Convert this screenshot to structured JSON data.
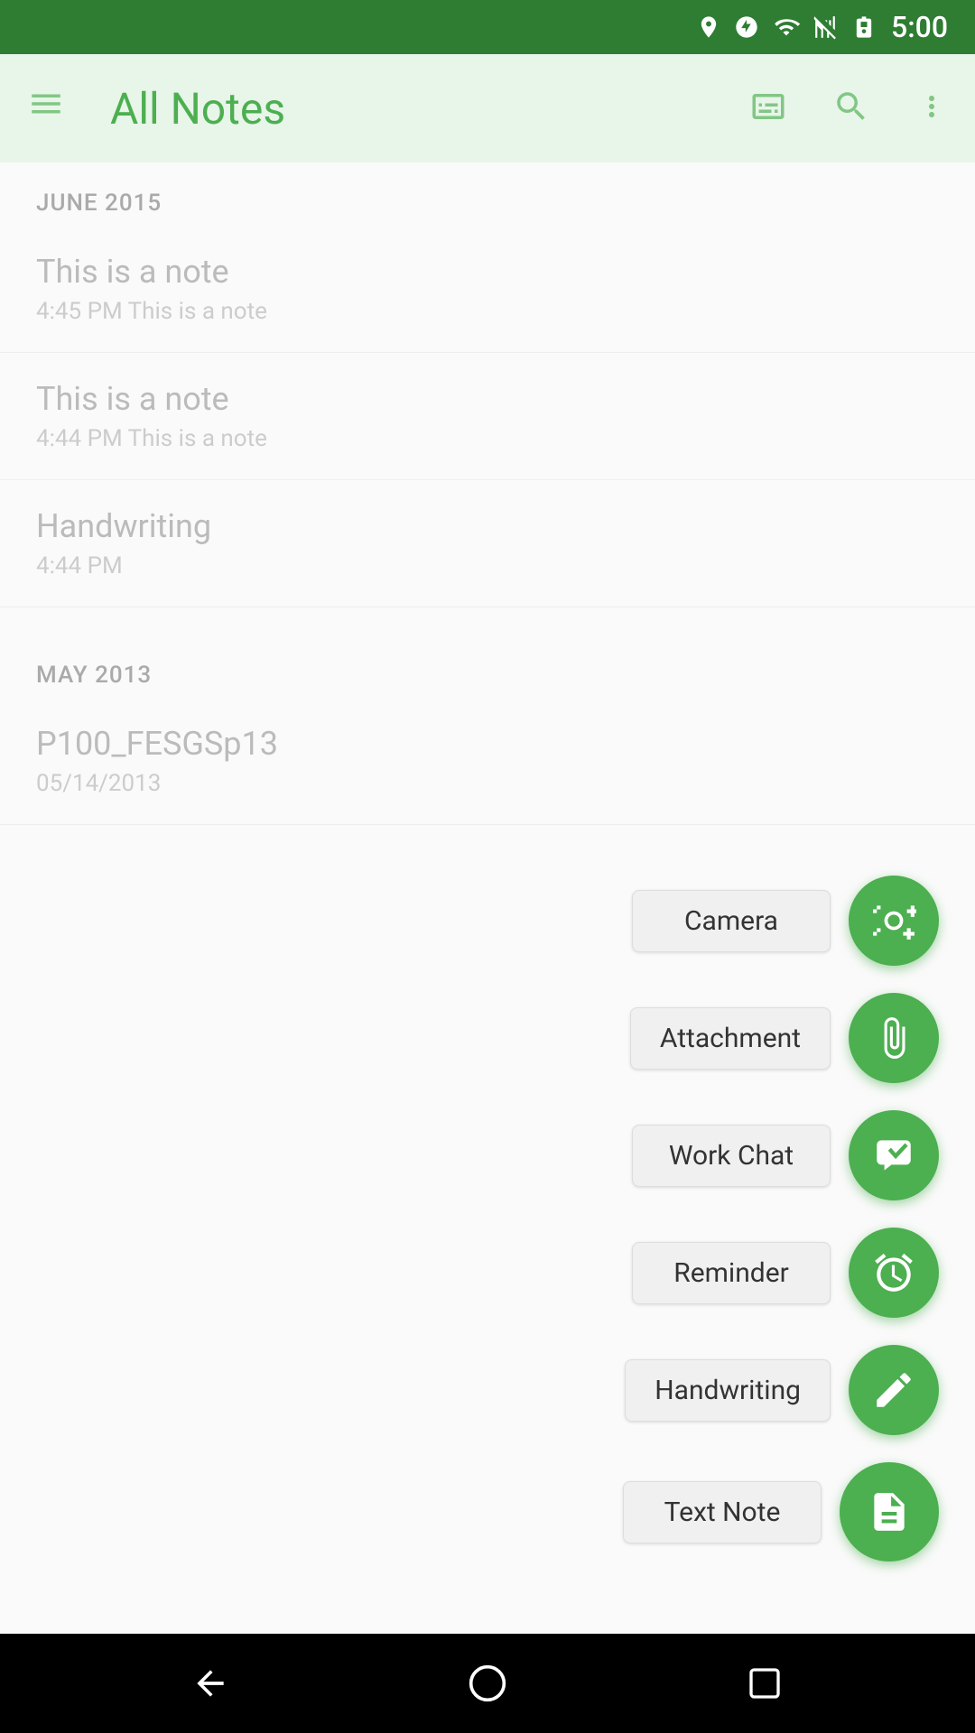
{
  "statusBar": {
    "time": "5:00",
    "icons": [
      "location",
      "block",
      "wifi",
      "signal",
      "battery"
    ]
  },
  "appBar": {
    "title": "All Notes",
    "menuIcon": "≡",
    "syncIcon": "⊟",
    "searchIcon": "🔍",
    "moreIcon": "⋮"
  },
  "sections": [
    {
      "header": "JUNE 2015",
      "notes": [
        {
          "title": "This is a note",
          "subtitle": "4:45 PM This is a note"
        },
        {
          "title": "This is a note",
          "subtitle": "4:44 PM This is a note"
        },
        {
          "title": "Handwriting",
          "subtitle": "4:44 PM"
        }
      ]
    },
    {
      "header": "MAY 2013",
      "notes": [
        {
          "title": "P100_FESGSp13",
          "subtitle": "05/14/2013"
        }
      ]
    }
  ],
  "fabMenu": {
    "items": [
      {
        "label": "Camera",
        "icon": "camera"
      },
      {
        "label": "Attachment",
        "icon": "attachment"
      },
      {
        "label": "Work Chat",
        "icon": "workchat"
      },
      {
        "label": "Reminder",
        "icon": "reminder"
      },
      {
        "label": "Handwriting",
        "icon": "handwriting"
      },
      {
        "label": "Text Note",
        "icon": "textnote"
      }
    ]
  },
  "navBar": {
    "back": "◁",
    "home": "○",
    "recents": "□"
  }
}
